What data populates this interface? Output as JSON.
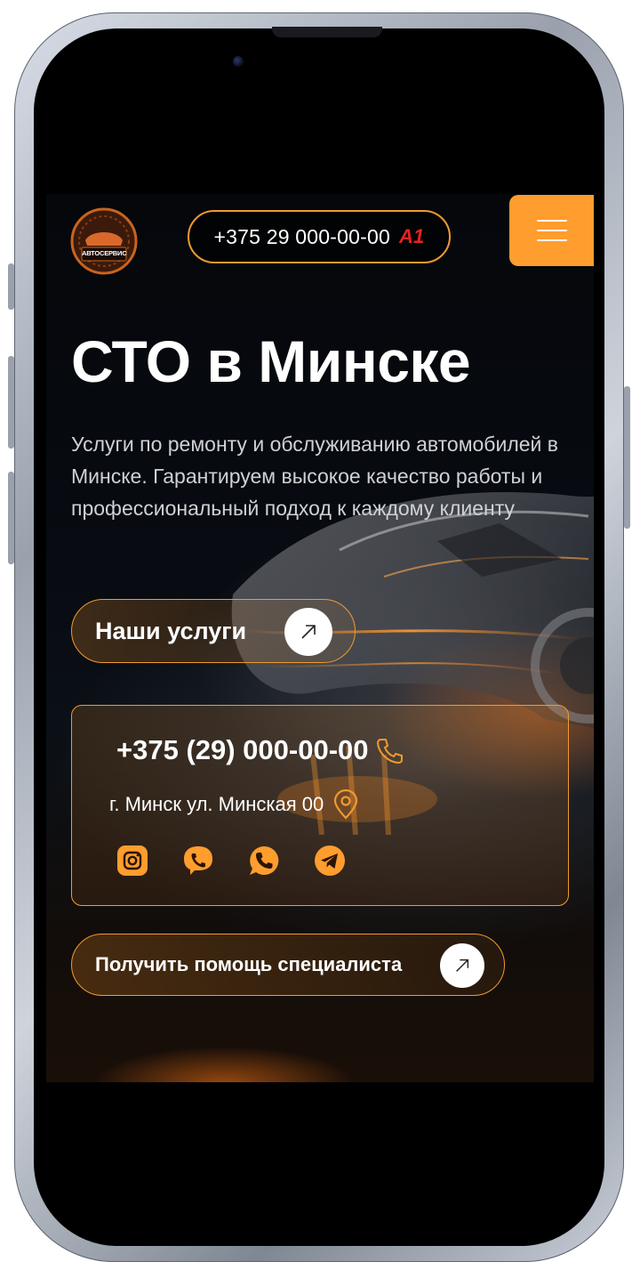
{
  "colors": {
    "accent": "#ff9d2e",
    "border_accent": "#f29a2e",
    "brand_a1": "#e5231f",
    "background": "#05070b"
  },
  "header": {
    "logo_text": "АВТОСЕРВИС",
    "phone": "+375 29 000-00-00",
    "operator_badge": "A1",
    "menu_icon": "hamburger-icon"
  },
  "hero": {
    "title": "СТО в Минске",
    "subtitle": "Услуги по ремонту и обслуживанию автомобилей в Минске. Гарантируем высокое качество работы и профессиональный подход к каждому клиенту",
    "services_button": "Наши услуги"
  },
  "contact": {
    "phone": "+375 (29) 000-00-00",
    "address": "г. Минск ул. Минская 00",
    "phone_icon": "phone-icon",
    "location_icon": "location-pin-icon",
    "socials": [
      "instagram-icon",
      "viber-icon",
      "whatsapp-icon",
      "telegram-icon"
    ]
  },
  "help_button": "Получить помощь специалиста"
}
